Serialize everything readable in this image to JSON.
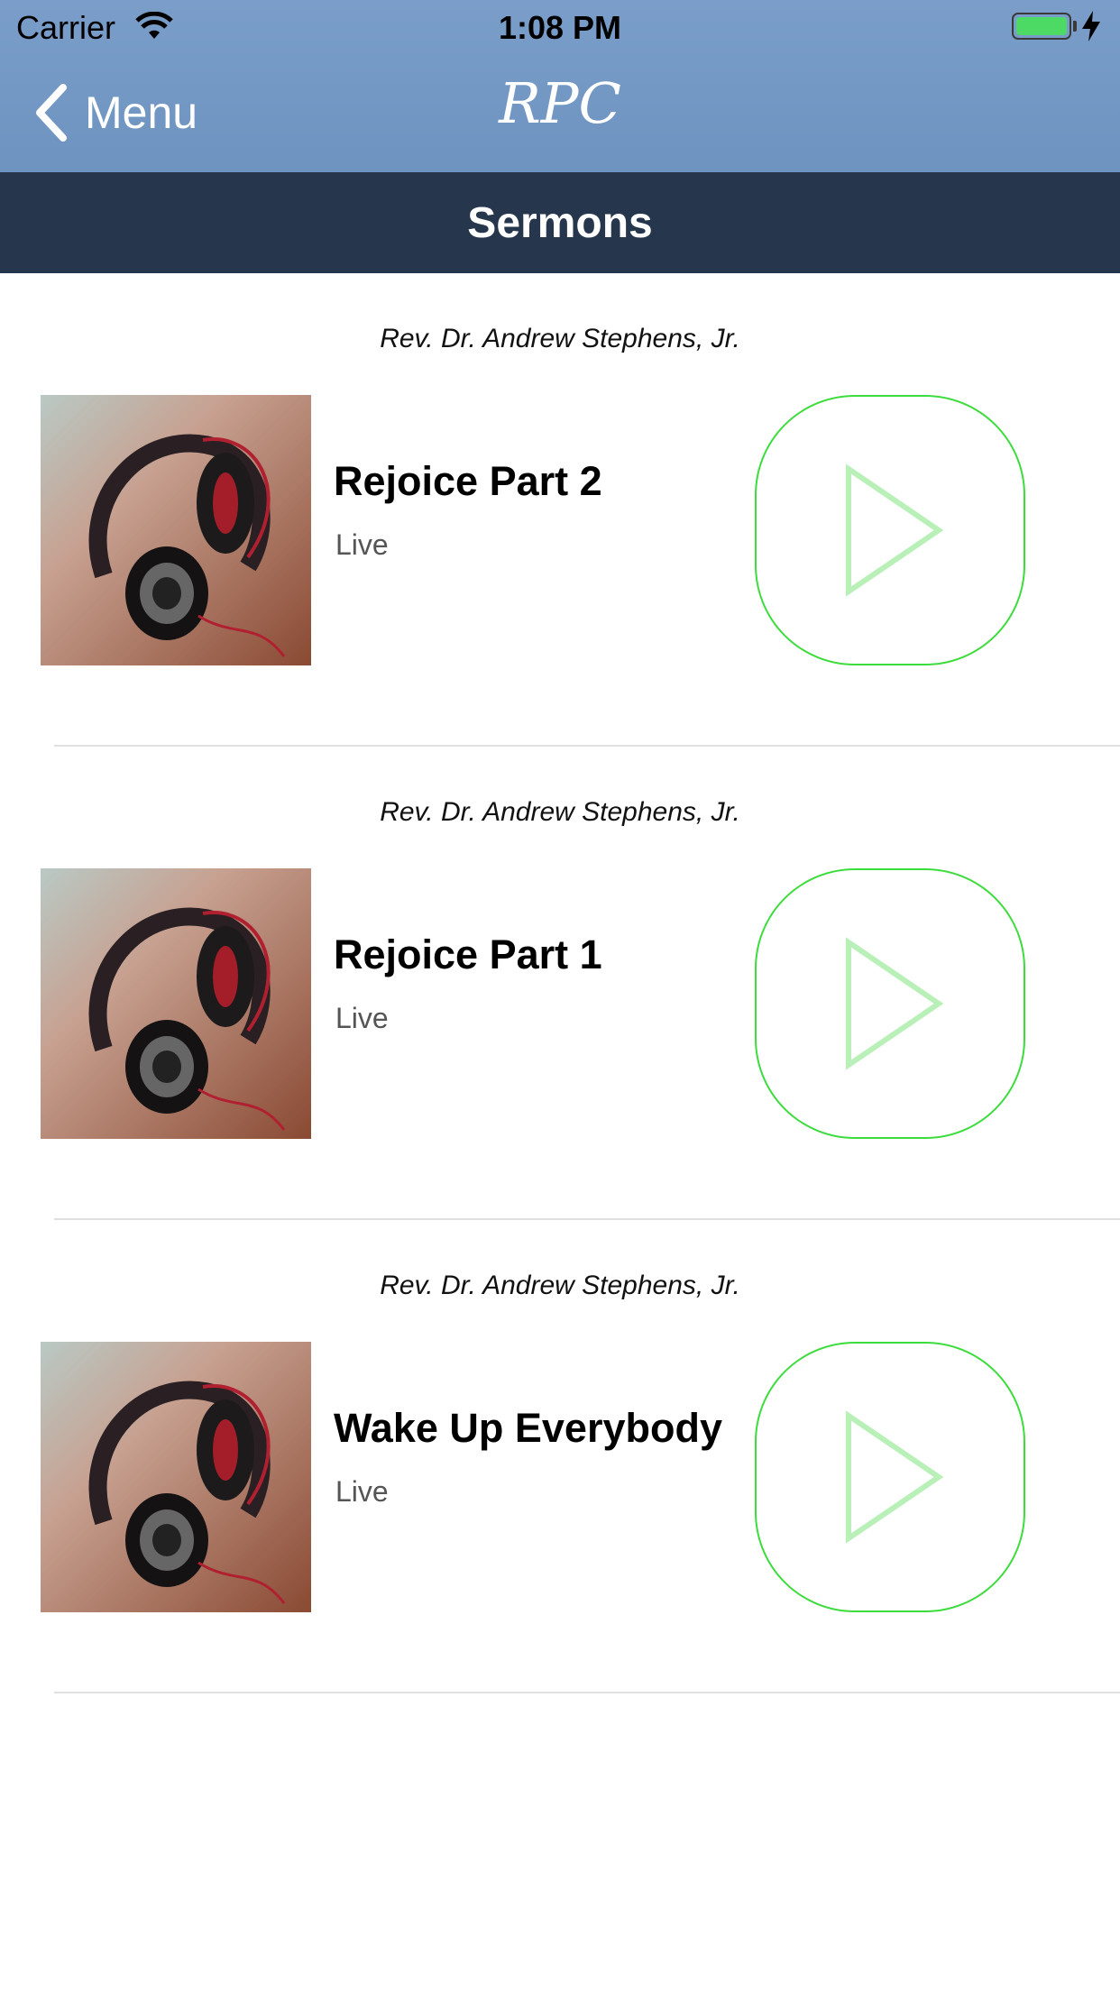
{
  "status_bar": {
    "carrier": "Carrier",
    "time": "1:08 PM",
    "battery_color": "#4cd964"
  },
  "nav": {
    "back_label": "Menu",
    "brand": "RPC"
  },
  "section": {
    "title": "Sermons"
  },
  "sermons": [
    {
      "speaker": "Rev. Dr. Andrew Stephens, Jr.",
      "title": "Rejoice Part 2",
      "subtitle": "Live"
    },
    {
      "speaker": "Rev. Dr. Andrew Stephens, Jr.",
      "title": "Rejoice Part 1",
      "subtitle": "Live"
    },
    {
      "speaker": "Rev. Dr. Andrew Stephens, Jr.",
      "title": "Wake Up Everybody",
      "subtitle": "Live"
    }
  ],
  "icons": {
    "play_icon": "play-icon",
    "thumbnail": "headphones-image"
  },
  "colors": {
    "play_outline": "#3ddc3d",
    "play_glyph": "#b8f0b8",
    "section_bar": "#26364d",
    "nav_bar": "#7297c4"
  }
}
